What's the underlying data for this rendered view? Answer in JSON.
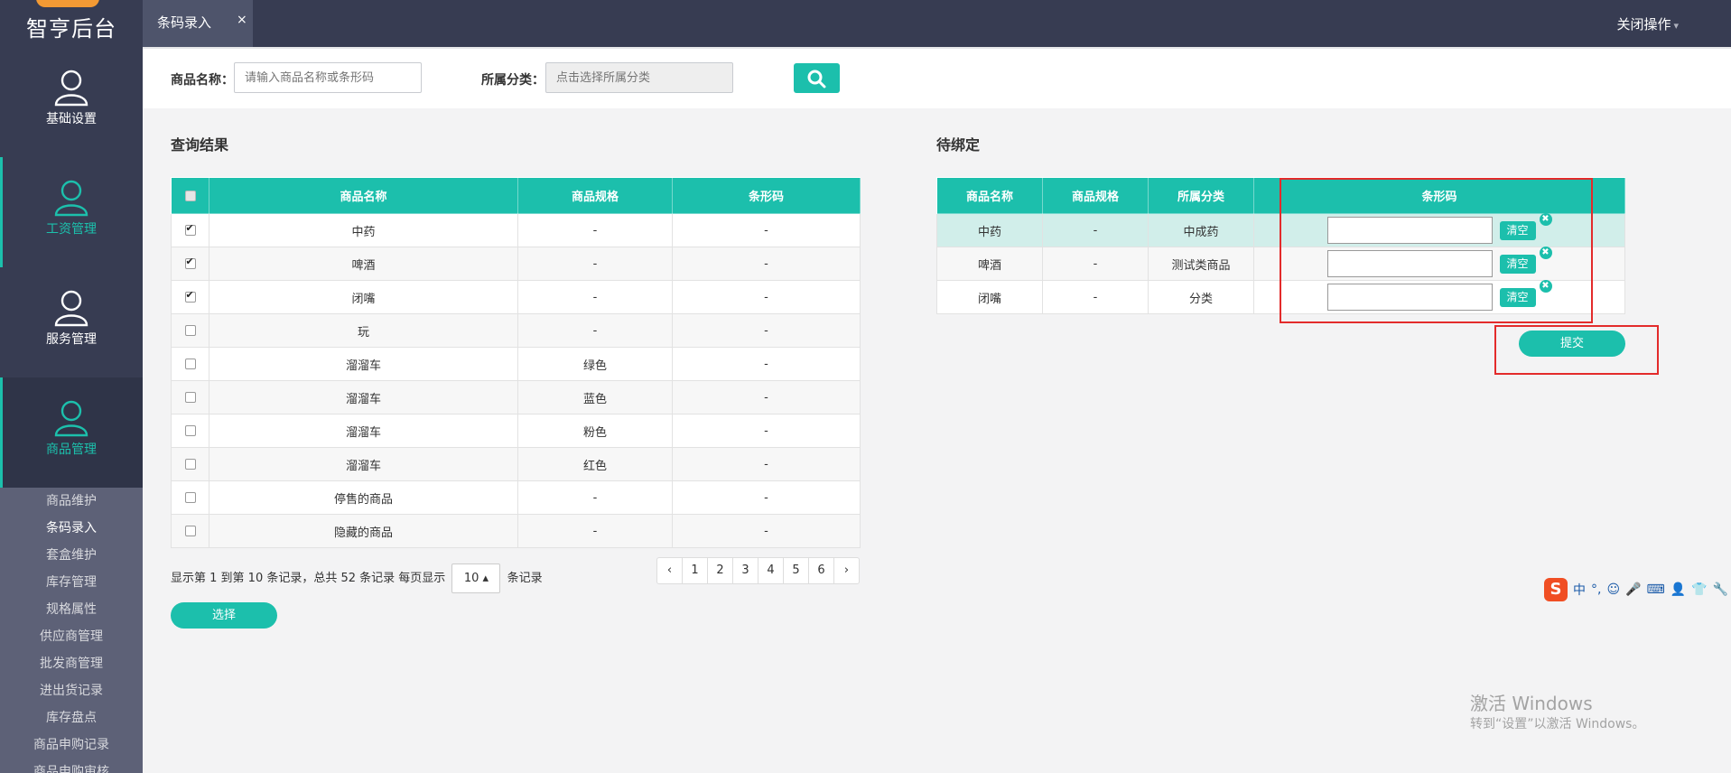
{
  "app": {
    "logo": "智亨后台"
  },
  "sidebar": {
    "nav": [
      {
        "label": "基础设置",
        "icon": "user-icon"
      },
      {
        "label": "工资管理",
        "icon": "user-icon"
      },
      {
        "label": "服务管理",
        "icon": "user-icon"
      },
      {
        "label": "商品管理",
        "icon": "user-icon"
      }
    ],
    "submenu": [
      "商品维护",
      "条码录入",
      "套盒维护",
      "库存管理",
      "规格属性",
      "供应商管理",
      "批发商管理",
      "进出货记录",
      "库存盘点",
      "商品申购记录",
      "商品申购审核"
    ]
  },
  "topbar": {
    "tab_label": "条码录入",
    "tab_close": "×",
    "close_ops": "关闭操作",
    "caret": "▾"
  },
  "search": {
    "name_label": "商品名称：",
    "name_placeholder": "请输入商品名称或条形码",
    "category_label": "所属分类：",
    "category_placeholder": "点击选择所属分类"
  },
  "results": {
    "title": "查询结果",
    "columns": [
      "商品名称",
      "商品规格",
      "条形码"
    ],
    "rows": [
      {
        "name": "中药",
        "spec": "-",
        "barcode": "-",
        "checked": true
      },
      {
        "name": "啤酒",
        "spec": "-",
        "barcode": "-",
        "checked": true
      },
      {
        "name": "闭嘴",
        "spec": "-",
        "barcode": "-",
        "checked": true
      },
      {
        "name": "玩",
        "spec": "-",
        "barcode": "-",
        "checked": false
      },
      {
        "name": "溜溜车",
        "spec": "绿色",
        "barcode": "-",
        "checked": false
      },
      {
        "name": "溜溜车",
        "spec": "蓝色",
        "barcode": "-",
        "checked": false
      },
      {
        "name": "溜溜车",
        "spec": "粉色",
        "barcode": "-",
        "checked": false
      },
      {
        "name": "溜溜车",
        "spec": "红色",
        "barcode": "-",
        "checked": false
      },
      {
        "name": "停售的商品",
        "spec": "-",
        "barcode": "-",
        "checked": false
      },
      {
        "name": "隐藏的商品",
        "spec": "-",
        "barcode": "-",
        "checked": false
      }
    ],
    "pagination_text_1": "显示第 1 到第 10 条记录，总共 52 条记录 每页显示",
    "page_size": "10 ▴",
    "pagination_text_2": "条记录",
    "pages": [
      "‹",
      "1",
      "2",
      "3",
      "4",
      "5",
      "6",
      "›"
    ],
    "select_button": "选择"
  },
  "pending": {
    "title": "待绑定",
    "columns": [
      "商品名称",
      "商品规格",
      "所属分类",
      "条形码"
    ],
    "rows": [
      {
        "name": "中药",
        "spec": "-",
        "category": "中成药",
        "barcode": ""
      },
      {
        "name": "啤酒",
        "spec": "-",
        "category": "测试类商品",
        "barcode": ""
      },
      {
        "name": "闭嘴",
        "spec": "-",
        "category": "分类",
        "barcode": ""
      }
    ],
    "clear_label": "清空",
    "remove_glyph": "✖",
    "submit_button": "提交"
  },
  "ime": {
    "logo": "S",
    "mode": "中",
    "punct": "°,",
    "smile": "☺",
    "mic": "🎤",
    "keyboard": "⌨",
    "person": "👤",
    "shirt": "👕",
    "wrench": "🔧"
  },
  "watermark": {
    "line1": "激活 Windows",
    "line2": "转到“设置”以激活 Windows。"
  },
  "colors": {
    "accent": "#1cbfac",
    "sidebar": "#373c52",
    "highlight": "#e32b2b"
  }
}
